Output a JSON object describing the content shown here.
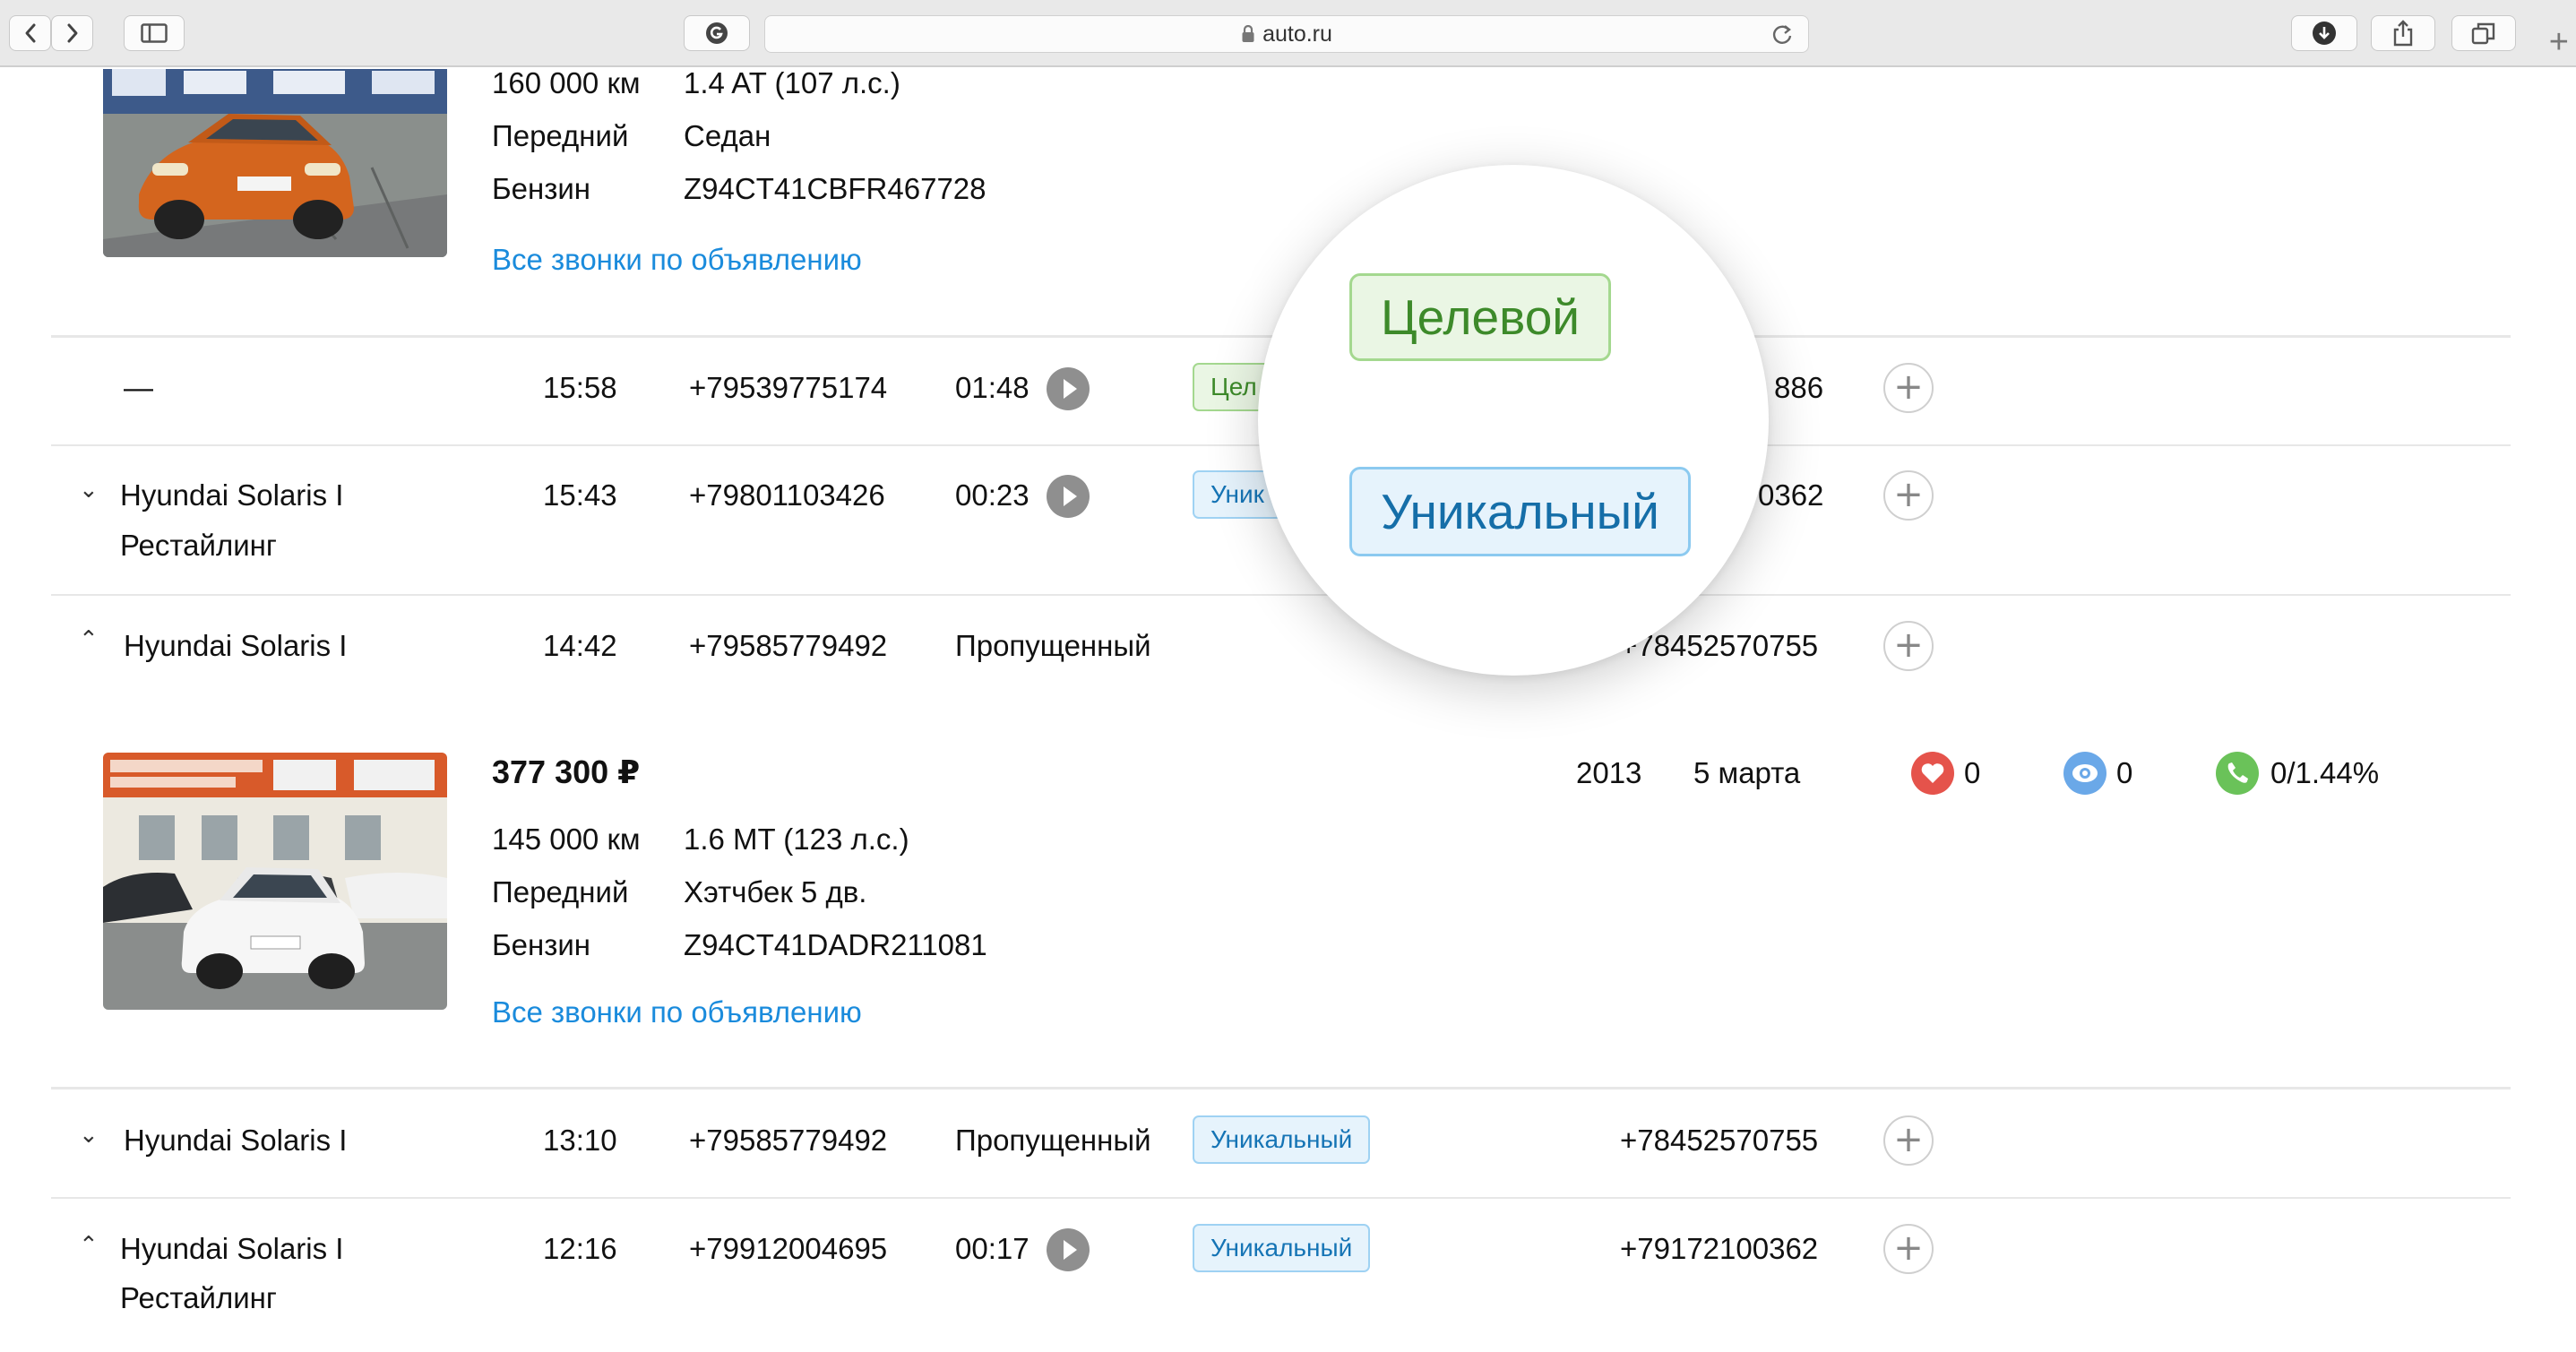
{
  "browser": {
    "url": "auto.ru",
    "icons": [
      "back-icon",
      "forward-icon",
      "sidebar-icon",
      "site-favicon",
      "lock-icon",
      "reload-icon",
      "download-icon",
      "share-icon",
      "tabs-icon",
      "new-tab-icon"
    ],
    "new_tab": "+"
  },
  "listing_top": {
    "mileage": "160 000 км",
    "engine": "1.4 AT (107 л.с.)",
    "drive": "Передний",
    "body": "Седан",
    "fuel": "Бензин",
    "vin": "Z94CT41CBFR467728",
    "calls_link": "Все звонки по объявлению"
  },
  "rows": [
    {
      "car": "—",
      "time": "15:58",
      "phone": "+79539775174",
      "duration": "01:48",
      "tag": "Цел",
      "dest": "886"
    },
    {
      "car_line1": "Hyundai Solaris I",
      "car_line2": "Рестайлинг",
      "time": "15:43",
      "phone": "+79801103426",
      "duration": "00:23",
      "tag": "Уник",
      "dest": "0362"
    },
    {
      "car": "Hyundai Solaris I",
      "time": "14:42",
      "phone": "+79585779492",
      "status": "Пропущенный",
      "dest": "+78452570755"
    },
    {
      "car": "Hyundai Solaris I",
      "time": "13:10",
      "phone": "+79585779492",
      "status": "Пропущенный",
      "tag": "Уникальный",
      "dest": "+78452570755"
    },
    {
      "car_line1": "Hyundai Solaris I",
      "car_line2": "Рестайлинг",
      "time": "12:16",
      "phone": "+79912004695",
      "duration": "00:17",
      "tag": "Уникальный",
      "dest": "+79172100362"
    }
  ],
  "listing_expanded": {
    "price": "377 300 ₽",
    "year": "2013",
    "date": "5 марта",
    "likes": "0",
    "views": "0",
    "calls": "0/1.44%",
    "mileage": "145 000 км",
    "engine": "1.6 MT (123 л.с.)",
    "drive": "Передний",
    "body": "Хэтчбек 5 дв.",
    "fuel": "Бензин",
    "vin": "Z94CT41DADR211081",
    "calls_link": "Все звонки по объявлению"
  },
  "magnifier": {
    "target_label": "Целевой",
    "unique_label": "Уникальный"
  },
  "colors": {
    "link": "#1a8bdc",
    "unique_tag": "#1574b5",
    "target_tag": "#3d8a2a",
    "likes": "#e5534b",
    "views": "#6aa8e8",
    "calls": "#6ac259"
  }
}
